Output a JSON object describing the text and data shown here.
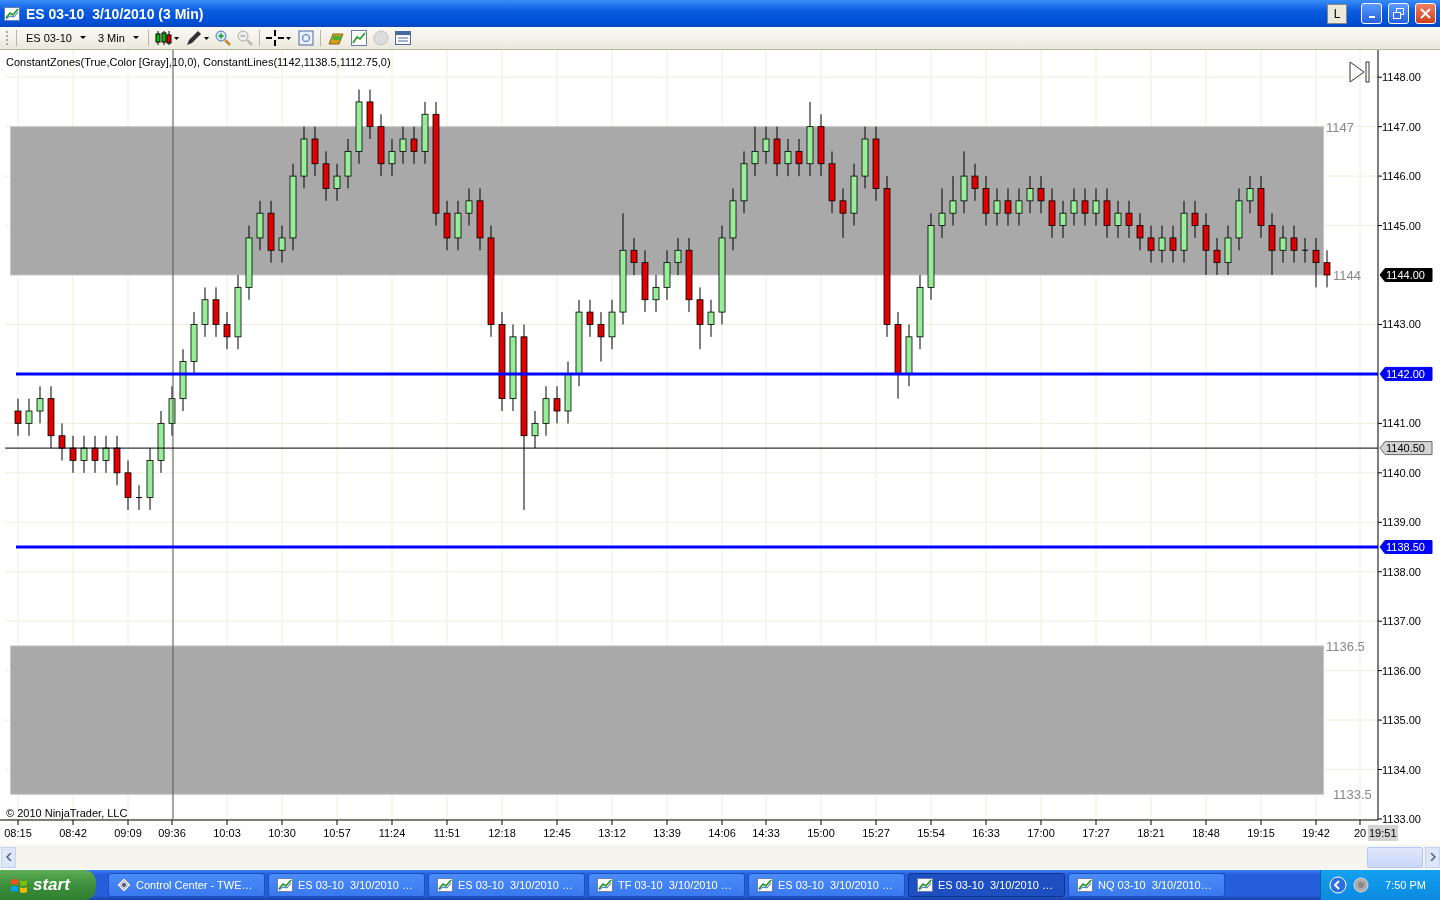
{
  "window": {
    "title": "ES 03-10  3/10/2010 (3 Min)",
    "title_buttons": [
      "L"
    ]
  },
  "toolbar": {
    "instrument": "ES 03-10",
    "interval": "3 Min"
  },
  "chart": {
    "indicator_label": "ConstantZones(True,Color [Gray],10,0), ConstantLines(1142,1138.5,1112.75,0)",
    "copyright": "© 2010 NinjaTrader, LLC",
    "zones": [
      {
        "upper": "1147",
        "lower": "1144"
      },
      {
        "upper": "1136.5",
        "lower": "1133.5"
      }
    ],
    "last_price": "1144.00",
    "cursor_time": "19:51",
    "chart_data": {
      "type": "candlestick",
      "grid": true,
      "ylim": [
        1133,
        1148.55
      ],
      "yticks": [
        {
          "value": 1133,
          "label": "1133.00"
        },
        {
          "value": 1134,
          "label": "1134.00"
        },
        {
          "value": 1135,
          "label": "1135.00"
        },
        {
          "value": 1136,
          "label": "1136.00"
        },
        {
          "value": 1137,
          "label": "1137.00"
        },
        {
          "value": 1138,
          "label": "1138.00"
        },
        {
          "value": 1139,
          "label": "1139.00"
        },
        {
          "value": 1140,
          "label": "1140.00"
        },
        {
          "value": 1141,
          "label": "1141.00"
        },
        {
          "value": 1143,
          "label": "1143.00"
        },
        {
          "value": 1145,
          "label": "1145.00"
        },
        {
          "value": 1146,
          "label": "1146.00"
        },
        {
          "value": 1147,
          "label": "1147.00"
        },
        {
          "value": 1148,
          "label": "1148.00"
        }
      ],
      "categories": [
        "08:15",
        null,
        null,
        null,
        null,
        "08:42",
        null,
        null,
        null,
        null,
        "09:09",
        null,
        null,
        null,
        "09:36",
        null,
        null,
        null,
        null,
        "10:03",
        null,
        null,
        null,
        null,
        "10:30",
        null,
        null,
        null,
        null,
        "10:57",
        null,
        null,
        null,
        null,
        "11:24",
        null,
        null,
        null,
        null,
        "11:51",
        null,
        null,
        null,
        null,
        "12:18",
        null,
        null,
        null,
        null,
        "12:45",
        null,
        null,
        null,
        null,
        "13:12",
        null,
        null,
        null,
        null,
        "13:39",
        null,
        null,
        null,
        null,
        "14:06",
        null,
        null,
        null,
        "14:33",
        null,
        null,
        null,
        null,
        "15:00",
        null,
        null,
        null,
        null,
        "15:27",
        null,
        null,
        null,
        null,
        "15:54",
        null,
        null,
        null,
        null,
        "16:33",
        null,
        null,
        null,
        null,
        "17:00",
        null,
        null,
        null,
        null,
        "17:27",
        null,
        null,
        null,
        null,
        "18:21",
        null,
        null,
        null,
        null,
        "18:48",
        null,
        null,
        null,
        null,
        "19:15",
        null,
        null,
        null,
        null,
        "19:42",
        null,
        null,
        null,
        "20"
      ],
      "ref_lines": [
        {
          "axis": "y",
          "value": 1142,
          "label": "1142.00",
          "color": "#0000ff"
        },
        {
          "axis": "y",
          "value": 1140.5,
          "label": "1140.50",
          "color": "#000000"
        },
        {
          "axis": "y",
          "value": 1138.5,
          "label": "1138.50",
          "color": "#0000ff"
        }
      ],
      "ohlc": [
        [
          1141.25,
          1141.5,
          1140.75,
          1141
        ],
        [
          1141,
          1141.5,
          1140.75,
          1141.25
        ],
        [
          1141.25,
          1141.75,
          1141,
          1141.5
        ],
        [
          1141.5,
          1141.75,
          1140.5,
          1140.75
        ],
        [
          1140.75,
          1141,
          1140.25,
          1140.5
        ],
        [
          1140.5,
          1140.75,
          1140,
          1140.25
        ],
        [
          1140.25,
          1140.75,
          1140,
          1140.5
        ],
        [
          1140.5,
          1140.75,
          1140,
          1140.25
        ],
        [
          1140.25,
          1140.75,
          1140,
          1140.5
        ],
        [
          1140.5,
          1140.75,
          1139.75,
          1140
        ],
        [
          1140,
          1140.25,
          1139.25,
          1139.5
        ],
        [
          1139.5,
          1139.75,
          1139.25,
          1139.5
        ],
        [
          1139.5,
          1140.5,
          1139.25,
          1140.25
        ],
        [
          1140.25,
          1141.25,
          1140,
          1141
        ],
        [
          1141,
          1141.75,
          1140.75,
          1141.5
        ],
        [
          1141.5,
          1142.5,
          1141.25,
          1142.25
        ],
        [
          1142.25,
          1143.25,
          1142,
          1143
        ],
        [
          1143,
          1143.75,
          1142.75,
          1143.5
        ],
        [
          1143.5,
          1143.75,
          1142.75,
          1143
        ],
        [
          1143,
          1143.25,
          1142.5,
          1142.75
        ],
        [
          1142.75,
          1144,
          1142.5,
          1143.75
        ],
        [
          1143.75,
          1145,
          1143.5,
          1144.75
        ],
        [
          1144.75,
          1145.5,
          1144.5,
          1145.25
        ],
        [
          1145.25,
          1145.5,
          1144.25,
          1144.5
        ],
        [
          1144.5,
          1145,
          1144.25,
          1144.75
        ],
        [
          1144.75,
          1146.25,
          1144.5,
          1146
        ],
        [
          1146,
          1147,
          1145.75,
          1146.75
        ],
        [
          1146.75,
          1147,
          1146,
          1146.25
        ],
        [
          1146.25,
          1146.5,
          1145.5,
          1145.75
        ],
        [
          1145.75,
          1146.25,
          1145.5,
          1146
        ],
        [
          1146,
          1146.75,
          1145.75,
          1146.5
        ],
        [
          1146.5,
          1147.75,
          1146.25,
          1147.5
        ],
        [
          1147.5,
          1147.75,
          1146.75,
          1147
        ],
        [
          1147,
          1147.25,
          1146,
          1146.25
        ],
        [
          1146.25,
          1146.75,
          1146,
          1146.5
        ],
        [
          1146.5,
          1147,
          1146.25,
          1146.75
        ],
        [
          1146.75,
          1147,
          1146.25,
          1146.5
        ],
        [
          1146.5,
          1147.5,
          1146.25,
          1147.25
        ],
        [
          1147.25,
          1147.5,
          1145,
          1145.25
        ],
        [
          1145.25,
          1145.5,
          1144.5,
          1144.75
        ],
        [
          1144.75,
          1145.5,
          1144.5,
          1145.25
        ],
        [
          1145.25,
          1145.75,
          1145,
          1145.5
        ],
        [
          1145.5,
          1145.75,
          1144.5,
          1144.75
        ],
        [
          1144.75,
          1145,
          1142.75,
          1143
        ],
        [
          1143,
          1143.25,
          1141.25,
          1141.5
        ],
        [
          1141.5,
          1143,
          1141.25,
          1142.75
        ],
        [
          1142.75,
          1143,
          1139.25,
          1140.75
        ],
        [
          1140.75,
          1141.25,
          1140.5,
          1141
        ],
        [
          1141,
          1141.75,
          1140.75,
          1141.5
        ],
        [
          1141.5,
          1141.75,
          1141,
          1141.25
        ],
        [
          1141.25,
          1142.25,
          1141,
          1142
        ],
        [
          1142,
          1143.5,
          1141.75,
          1143.25
        ],
        [
          1143.25,
          1143.5,
          1142.75,
          1143
        ],
        [
          1143,
          1143.25,
          1142.25,
          1142.75
        ],
        [
          1142.75,
          1143.5,
          1142.5,
          1143.25
        ],
        [
          1143.25,
          1145.25,
          1143,
          1144.5
        ],
        [
          1144.5,
          1144.75,
          1144,
          1144.25
        ],
        [
          1144.25,
          1144.5,
          1143.25,
          1143.5
        ],
        [
          1143.5,
          1144,
          1143.25,
          1143.75
        ],
        [
          1143.75,
          1144.5,
          1143.5,
          1144.25
        ],
        [
          1144.25,
          1144.75,
          1144,
          1144.5
        ],
        [
          1144.5,
          1144.75,
          1143.25,
          1143.5
        ],
        [
          1143.5,
          1143.75,
          1142.5,
          1143
        ],
        [
          1143,
          1143.5,
          1142.75,
          1143.25
        ],
        [
          1143.25,
          1145,
          1143,
          1144.75
        ],
        [
          1144.75,
          1145.75,
          1144.5,
          1145.5
        ],
        [
          1145.5,
          1146.5,
          1145.25,
          1146.25
        ],
        [
          1146.25,
          1147,
          1146,
          1146.5
        ],
        [
          1146.5,
          1147,
          1146.25,
          1146.75
        ],
        [
          1146.75,
          1147,
          1146,
          1146.25
        ],
        [
          1146.25,
          1146.75,
          1146,
          1146.5
        ],
        [
          1146.5,
          1146.75,
          1146,
          1146.25
        ],
        [
          1146.25,
          1147.5,
          1146,
          1147
        ],
        [
          1147,
          1147.25,
          1146,
          1146.25
        ],
        [
          1146.25,
          1146.5,
          1145.25,
          1145.5
        ],
        [
          1145.5,
          1145.75,
          1144.75,
          1145.25
        ],
        [
          1145.25,
          1146.25,
          1145,
          1146
        ],
        [
          1146,
          1147,
          1145.75,
          1146.75
        ],
        [
          1146.75,
          1147,
          1145.5,
          1145.75
        ],
        [
          1145.75,
          1146,
          1142.75,
          1143
        ],
        [
          1143,
          1143.25,
          1141.5,
          1142
        ],
        [
          1142,
          1143,
          1141.75,
          1142.75
        ],
        [
          1142.75,
          1144,
          1142.5,
          1143.75
        ],
        [
          1143.75,
          1145.25,
          1143.5,
          1145
        ],
        [
          1145,
          1145.75,
          1144.75,
          1145.25
        ],
        [
          1145.25,
          1146,
          1145,
          1145.5
        ],
        [
          1145.5,
          1146.5,
          1145.25,
          1146
        ],
        [
          1146,
          1146.25,
          1145.5,
          1145.75
        ],
        [
          1145.75,
          1146,
          1145,
          1145.25
        ],
        [
          1145.25,
          1145.75,
          1145,
          1145.5
        ],
        [
          1145.5,
          1145.75,
          1145,
          1145.25
        ],
        [
          1145.25,
          1145.75,
          1145,
          1145.5
        ],
        [
          1145.5,
          1146,
          1145.25,
          1145.75
        ],
        [
          1145.75,
          1146,
          1145.25,
          1145.5
        ],
        [
          1145.5,
          1145.75,
          1144.75,
          1145
        ],
        [
          1145,
          1145.5,
          1144.75,
          1145.25
        ],
        [
          1145.25,
          1145.75,
          1145,
          1145.5
        ],
        [
          1145.5,
          1145.75,
          1145,
          1145.25
        ],
        [
          1145.25,
          1145.75,
          1145,
          1145.5
        ],
        [
          1145.5,
          1145.75,
          1144.75,
          1145
        ],
        [
          1145,
          1145.5,
          1144.75,
          1145.25
        ],
        [
          1145.25,
          1145.5,
          1144.75,
          1145
        ],
        [
          1145,
          1145.25,
          1144.5,
          1144.75
        ],
        [
          1144.75,
          1145,
          1144.25,
          1144.5
        ],
        [
          1144.5,
          1145,
          1144.25,
          1144.75
        ],
        [
          1144.75,
          1145,
          1144.25,
          1144.5
        ],
        [
          1144.5,
          1145.5,
          1144.25,
          1145.25
        ],
        [
          1145.25,
          1145.5,
          1144.75,
          1145
        ],
        [
          1145,
          1145.25,
          1144,
          1144.5
        ],
        [
          1144.5,
          1144.75,
          1144,
          1144.25
        ],
        [
          1144.25,
          1145,
          1144,
          1144.75
        ],
        [
          1144.75,
          1145.75,
          1144.5,
          1145.5
        ],
        [
          1145.5,
          1146,
          1145.25,
          1145.75
        ],
        [
          1145.75,
          1146,
          1144.75,
          1145
        ],
        [
          1145,
          1145.25,
          1144,
          1144.5
        ],
        [
          1144.5,
          1145,
          1144.25,
          1144.75
        ],
        [
          1144.75,
          1145,
          1144.25,
          1144.5
        ],
        [
          1144.5,
          1144.75,
          1144.25,
          1144.5
        ],
        [
          1144.5,
          1144.75,
          1143.75,
          1144.25
        ],
        [
          1144.25,
          1144.5,
          1143.75,
          1144
        ],
        null,
        null,
        null
      ]
    }
  },
  "taskbar": {
    "start": "start",
    "items": [
      {
        "kind": "control",
        "label": "Control Center - TWE…",
        "selected": false
      },
      {
        "kind": "chart",
        "label": "ES 03-10  3/10/2010 …",
        "selected": false
      },
      {
        "kind": "chart",
        "label": "ES 03-10  3/10/2010 …",
        "selected": false
      },
      {
        "kind": "chart",
        "label": "TF 03-10  3/10/2010 …",
        "selected": false
      },
      {
        "kind": "chart",
        "label": "ES 03-10  3/10/2010 …",
        "selected": false
      },
      {
        "kind": "chart",
        "label": "ES 03-10  3/10/2010 …",
        "selected": true
      },
      {
        "kind": "chart",
        "label": "NQ 03-10  3/10/2010…",
        "selected": false
      }
    ],
    "clock": "7:50 PM"
  }
}
